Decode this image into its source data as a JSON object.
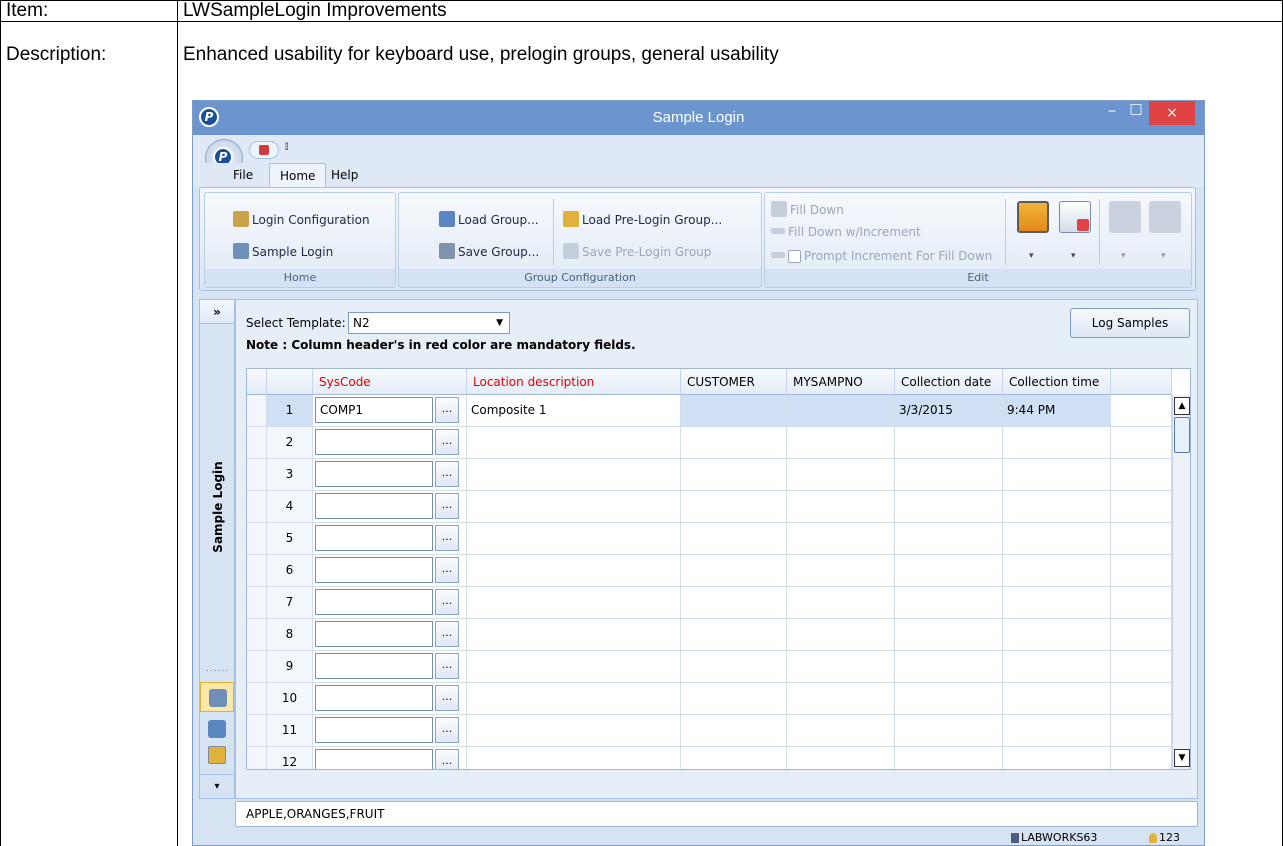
{
  "doc": {
    "item_label": "Item:",
    "item_value": "LWSampleLogin Improvements",
    "desc_label": "Description:",
    "desc_value": "Enhanced usability for keyboard use, prelogin groups, general usability"
  },
  "window": {
    "title": "Sample Login",
    "qat_dropdown": "⫾",
    "menu_tabs": [
      "File",
      "Home",
      "Help"
    ],
    "controls": {
      "minimize": "‒",
      "maximize": "□",
      "close": "×"
    }
  },
  "ribbon": {
    "home_group": {
      "label": "Home",
      "login_configuration": "Login Configuration",
      "sample_login": "Sample Login"
    },
    "group_configuration": {
      "label": "Group Configuration",
      "load_group": "Load Group...",
      "save_group": "Save Group...",
      "load_prelogin_group": "Load Pre-Login Group...",
      "save_prelogin_group": "Save Pre-Login Group"
    },
    "edit_group": {
      "label": "Edit",
      "fill_down": "Fill Down",
      "fill_down_increment": "Fill Down w/Increment",
      "prompt_increment": "Prompt Increment For Fill Down"
    }
  },
  "sidebar": {
    "collapse_glyph": "»",
    "label": "Sample Login",
    "grip": "......",
    "more_glyph": "▾"
  },
  "content": {
    "select_template_label": "Select Template:",
    "template_value": "N2",
    "note": "Note : Column header's in red color are mandatory fields.",
    "log_samples_button": "Log Samples"
  },
  "grid": {
    "columns": [
      "SysCode",
      "Location description",
      "CUSTOMER",
      "MYSAMPNO",
      "Collection date",
      "Collection time"
    ],
    "required_columns": [
      true,
      true,
      false,
      false,
      false,
      false
    ],
    "ellipsis": "...",
    "rows": [
      {
        "num": "1",
        "syscode": "COMP1",
        "location": "Composite 1",
        "customer": "",
        "mysampno": "",
        "date": "3/3/2015",
        "time": "9:44 PM"
      },
      {
        "num": "2"
      },
      {
        "num": "3"
      },
      {
        "num": "4"
      },
      {
        "num": "5"
      },
      {
        "num": "6"
      },
      {
        "num": "7"
      },
      {
        "num": "8"
      },
      {
        "num": "9"
      },
      {
        "num": "10"
      },
      {
        "num": "11"
      },
      {
        "num": "12"
      }
    ],
    "scroll_up": "▲",
    "scroll_down": "▼"
  },
  "footer": {
    "text": "APPLE,ORANGES,FRUIT"
  },
  "status": {
    "database": "LABWORKS63",
    "user": "123"
  },
  "colors": {
    "titlebar": "#6c95cf",
    "required_header": "#e00000",
    "close_button": "#e04343",
    "selected_row": "#cfe0f5"
  }
}
